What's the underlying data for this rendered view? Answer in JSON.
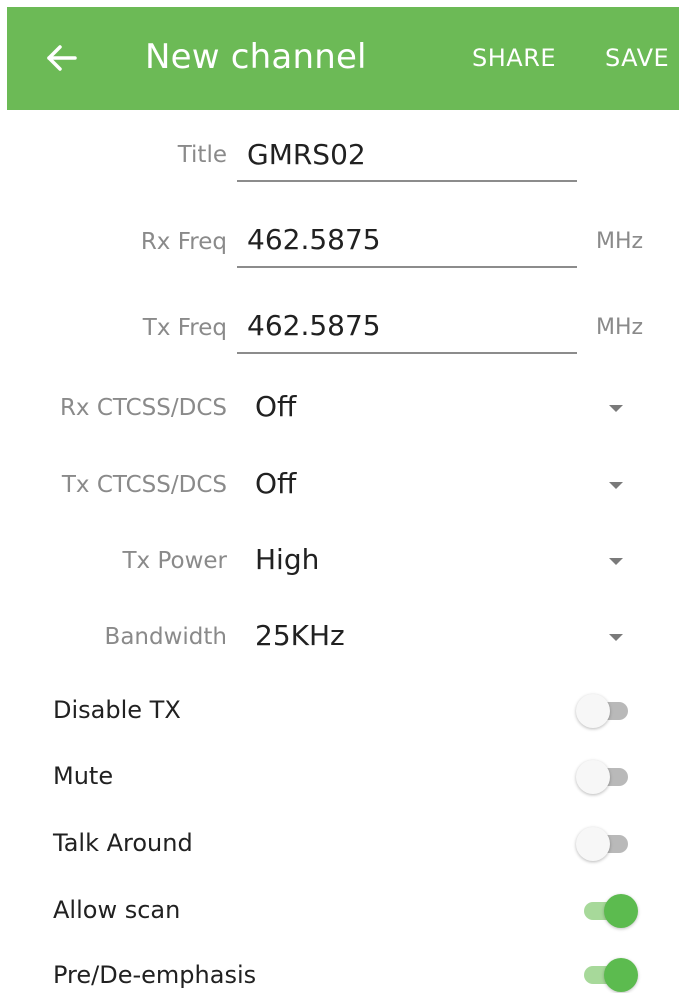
{
  "header": {
    "back_icon": "arrow-left-icon",
    "title": "New channel",
    "share_label": "SHARE",
    "save_label": "SAVE",
    "color": "#6cba56"
  },
  "form": {
    "title": {
      "label": "Title",
      "value": "GMRS02"
    },
    "rx_freq": {
      "label": "Rx Freq",
      "value": "462.5875",
      "unit": "MHz"
    },
    "tx_freq": {
      "label": "Tx Freq",
      "value": "462.5875",
      "unit": "MHz"
    },
    "rx_ctcss": {
      "label": "Rx CTCSS/DCS",
      "value": "Off",
      "icon": "dropdown-arrow-icon"
    },
    "tx_ctcss": {
      "label": "Tx CTCSS/DCS",
      "value": "Off",
      "icon": "dropdown-arrow-icon"
    },
    "tx_power": {
      "label": "Tx Power",
      "value": "High",
      "icon": "dropdown-arrow-icon"
    },
    "bandwidth": {
      "label": "Bandwidth",
      "value": "25KHz",
      "icon": "dropdown-arrow-icon"
    }
  },
  "switches": [
    {
      "label": "Disable TX",
      "on": false
    },
    {
      "label": "Mute",
      "on": false
    },
    {
      "label": "Talk Around",
      "on": false
    },
    {
      "label": "Allow scan",
      "on": true
    },
    {
      "label": "Pre/De-emphasis",
      "on": true
    }
  ],
  "colors": {
    "accent": "#5cbb4f",
    "switch_off_track": "#b9b9b9",
    "label_gray": "#8a8a8a"
  }
}
